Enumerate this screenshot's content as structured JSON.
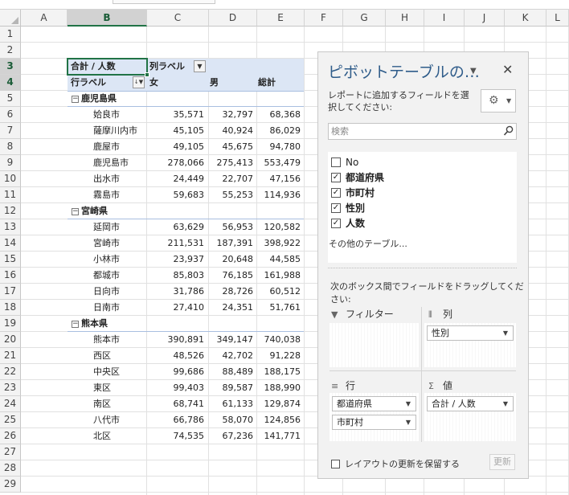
{
  "columns": [
    "A",
    "B",
    "C",
    "D",
    "E",
    "F",
    "G",
    "H",
    "I",
    "J",
    "K",
    "L"
  ],
  "rows": [
    "1",
    "2",
    "3",
    "4",
    "5",
    "6",
    "7",
    "8",
    "9",
    "10",
    "11",
    "12",
    "13",
    "14",
    "15",
    "16",
    "17",
    "18",
    "19",
    "20",
    "21",
    "22",
    "23",
    "24",
    "25",
    "26",
    "27",
    "28",
    "29"
  ],
  "selected_column": "B",
  "selected_rows": [
    "3",
    "4"
  ],
  "pivot": {
    "value_caption": "合計 / 人数",
    "col_labels_caption": "列ラベル",
    "row_labels_caption": "行ラベル",
    "col_headers": [
      "女",
      "男",
      "総計"
    ],
    "groups": [
      {
        "name": "鹿児島県",
        "rows": [
          {
            "label": "姶良市",
            "female": "35,571",
            "male": "32,797",
            "total": "68,368"
          },
          {
            "label": "薩摩川内市",
            "female": "45,105",
            "male": "40,924",
            "total": "86,029"
          },
          {
            "label": "鹿屋市",
            "female": "49,105",
            "male": "45,675",
            "total": "94,780"
          },
          {
            "label": "鹿児島市",
            "female": "278,066",
            "male": "275,413",
            "total": "553,479"
          },
          {
            "label": "出水市",
            "female": "24,449",
            "male": "22,707",
            "total": "47,156"
          },
          {
            "label": "霧島市",
            "female": "59,683",
            "male": "55,253",
            "total": "114,936"
          }
        ]
      },
      {
        "name": "宮崎県",
        "rows": [
          {
            "label": "延岡市",
            "female": "63,629",
            "male": "56,953",
            "total": "120,582"
          },
          {
            "label": "宮崎市",
            "female": "211,531",
            "male": "187,391",
            "total": "398,922"
          },
          {
            "label": "小林市",
            "female": "23,937",
            "male": "20,648",
            "total": "44,585"
          },
          {
            "label": "都城市",
            "female": "85,803",
            "male": "76,185",
            "total": "161,988"
          },
          {
            "label": "日向市",
            "female": "31,786",
            "male": "28,726",
            "total": "60,512"
          },
          {
            "label": "日南市",
            "female": "27,410",
            "male": "24,351",
            "total": "51,761"
          }
        ]
      },
      {
        "name": "熊本県",
        "rows": [
          {
            "label": "熊本市",
            "female": "390,891",
            "male": "349,147",
            "total": "740,038"
          },
          {
            "label": "西区",
            "female": "48,526",
            "male": "42,702",
            "total": "91,228"
          },
          {
            "label": "中央区",
            "female": "99,686",
            "male": "88,489",
            "total": "188,175"
          },
          {
            "label": "東区",
            "female": "99,403",
            "male": "89,587",
            "total": "188,990"
          },
          {
            "label": "南区",
            "female": "68,741",
            "male": "61,133",
            "total": "129,874"
          },
          {
            "label": "八代市",
            "female": "66,786",
            "male": "58,070",
            "total": "124,856"
          },
          {
            "label": "北区",
            "female": "74,535",
            "male": "67,236",
            "total": "141,771"
          }
        ]
      }
    ]
  },
  "field_pane": {
    "title": "ピボットテーブルの…",
    "description": "レポートに追加するフィールドを選択してください:",
    "search_placeholder": "検索",
    "fields": [
      {
        "name": "No",
        "checked": false
      },
      {
        "name": "都道府県",
        "checked": true
      },
      {
        "name": "市町村",
        "checked": true
      },
      {
        "name": "性別",
        "checked": true
      },
      {
        "name": "人数",
        "checked": true
      }
    ],
    "more_tables": "その他のテーブル...",
    "drag_hint": "次のボックス間でフィールドをドラッグしてください:",
    "areas": {
      "filter": {
        "label": "フィルター",
        "items": []
      },
      "columns": {
        "label": "列",
        "items": [
          "性別"
        ]
      },
      "rows": {
        "label": "行",
        "items": [
          "都道府県",
          "市町村"
        ]
      },
      "values": {
        "label": "値",
        "items": [
          "合計 / 人数"
        ]
      }
    },
    "defer_update_label": "レイアウトの更新を保留する",
    "defer_update_checked": false,
    "update_button": "更新"
  },
  "icons": {
    "close": "close-icon",
    "settings": "gear-icon",
    "search": "search-icon",
    "filter": "filter-icon",
    "columns": "columns-icon",
    "rows": "rows-icon",
    "values": "sigma-icon"
  },
  "colors": {
    "accent": "#217346",
    "pivot_header_bg": "#dce6f5",
    "pane_title": "#2f5c8a"
  }
}
